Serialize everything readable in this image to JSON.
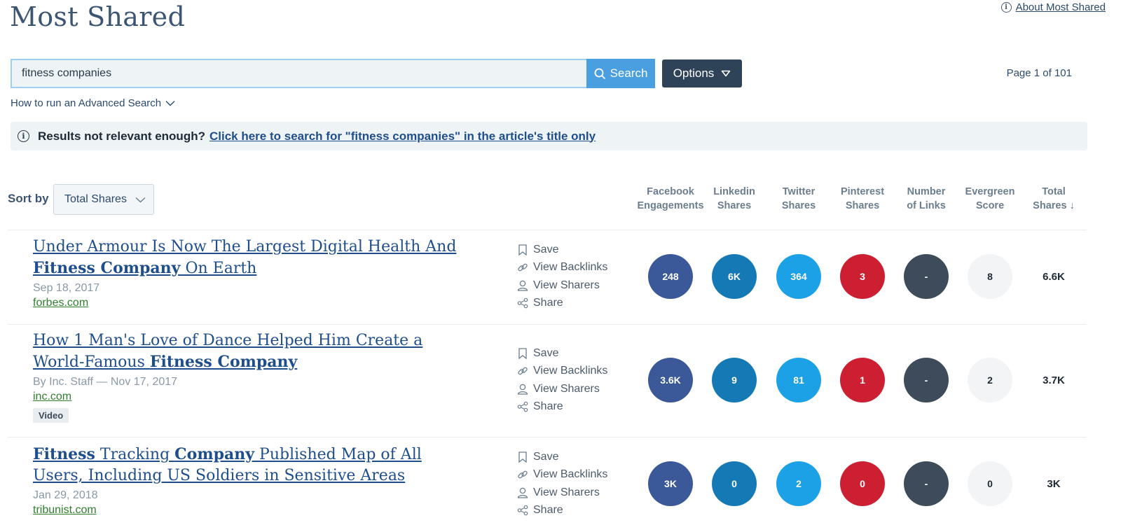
{
  "header": {
    "title": "Most Shared",
    "about_link": "About Most Shared"
  },
  "search": {
    "value": "fitness companies",
    "button_label": "Search",
    "options_label": "Options",
    "advanced_link": "How to run an Advanced Search",
    "page_info": "Page 1 of 101"
  },
  "notice": {
    "lead": "Results not relevant enough?",
    "link": "Click here to search for \"fitness companies\" in the article's title only"
  },
  "sort": {
    "label": "Sort by",
    "selected": "Total Shares"
  },
  "columns": [
    {
      "line1": "Facebook",
      "line2": "Engagements"
    },
    {
      "line1": "Linkedin",
      "line2": "Shares"
    },
    {
      "line1": "Twitter",
      "line2": "Shares"
    },
    {
      "line1": "Pinterest",
      "line2": "Shares"
    },
    {
      "line1": "Number",
      "line2": "of Links"
    },
    {
      "line1": "Evergreen",
      "line2": "Score"
    },
    {
      "line1": "Total",
      "line2": "Shares ↓"
    }
  ],
  "actions": {
    "save": "Save",
    "backlinks": "View Backlinks",
    "sharers": "View Sharers",
    "share": "Share"
  },
  "articles": [
    {
      "title_parts": [
        {
          "text": "Under Armour Is Now The Largest Digital Health And ",
          "bold": false
        },
        {
          "text": "Fitness Company",
          "bold": true
        },
        {
          "text": " On Earth",
          "bold": false
        }
      ],
      "meta": "Sep 18, 2017",
      "domain": "forbes.com",
      "tag": "",
      "metrics": {
        "facebook": "248",
        "linkedin": "6K",
        "twitter": "364",
        "pinterest": "3",
        "links": "-",
        "evergreen": "8",
        "total": "6.6K"
      }
    },
    {
      "title_parts": [
        {
          "text": "How 1 Man's Love of Dance Helped Him Create a World-Famous ",
          "bold": false
        },
        {
          "text": "Fitness Company",
          "bold": true
        }
      ],
      "meta": "By Inc. Staff — Nov 17, 2017",
      "domain": "inc.com",
      "tag": "Video",
      "metrics": {
        "facebook": "3.6K",
        "linkedin": "9",
        "twitter": "81",
        "pinterest": "1",
        "links": "-",
        "evergreen": "2",
        "total": "3.7K"
      }
    },
    {
      "title_parts": [
        {
          "text": "Fitness",
          "bold": true
        },
        {
          "text": " Tracking ",
          "bold": false
        },
        {
          "text": "Company",
          "bold": true
        },
        {
          "text": " Published Map of All Users, Including US Soldiers in Sensitive Areas",
          "bold": false
        }
      ],
      "meta": "Jan 29, 2018",
      "domain": "tribunist.com",
      "tag": "",
      "metrics": {
        "facebook": "3K",
        "linkedin": "0",
        "twitter": "2",
        "pinterest": "0",
        "links": "-",
        "evergreen": "0",
        "total": "3K"
      }
    }
  ],
  "icons": {
    "info": "info-icon",
    "search": "search-icon",
    "options_caret": "triangle-down-icon",
    "chevron": "chevron-down-icon",
    "bookmark": "bookmark-icon",
    "link": "link-icon",
    "user": "user-icon",
    "share": "share-icon"
  },
  "colors": {
    "facebook": "#3b5998",
    "linkedin": "#1479b4",
    "twitter": "#1da1e6",
    "pinterest": "#cc2032",
    "links": "#3d4b5b",
    "evergreen": "#f2f4f6",
    "title_link": "#1f4e8c",
    "domain": "#2f7d2f",
    "search_button": "#4a9fe0",
    "options_button": "#2e4258"
  }
}
